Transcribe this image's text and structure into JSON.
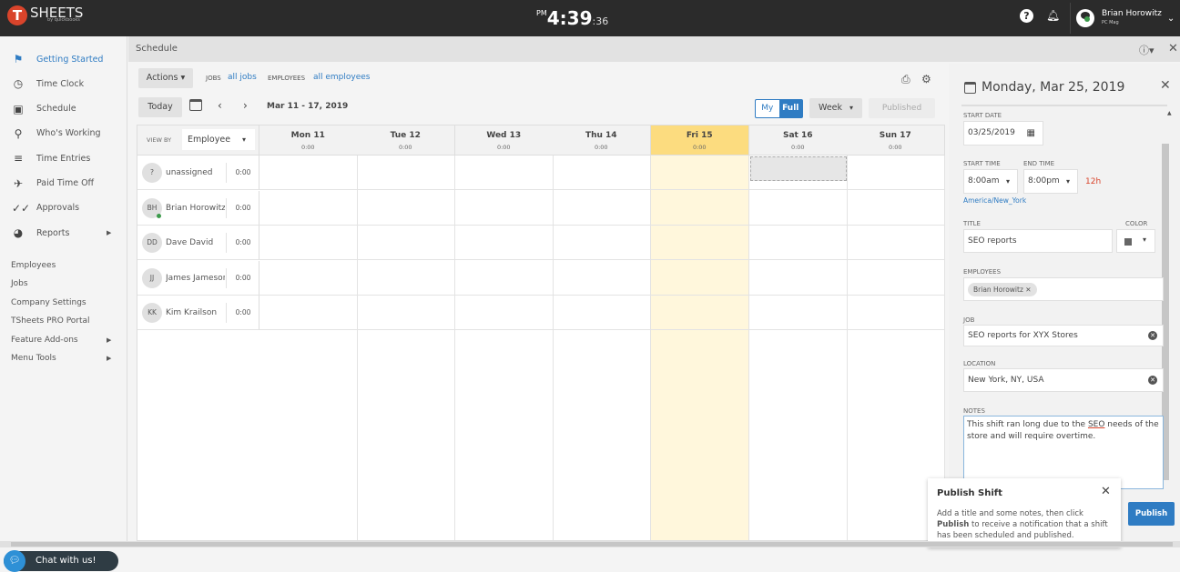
{
  "topbar": {
    "logo_letter": "T",
    "logo_text": "SHEETS",
    "logo_sub": "by quickbooks",
    "clock_ampm": "PM",
    "clock_hm": "4:39",
    "clock_sec": ":36",
    "help_icon": "?",
    "user_name": "Brian Horowitz",
    "user_org": "PC Mag"
  },
  "sidebar": {
    "items": [
      {
        "label": "Getting Started",
        "icon": "flag-icon",
        "glyph": "⚑",
        "active": true
      },
      {
        "label": "Time Clock",
        "icon": "clock-icon",
        "glyph": "◷"
      },
      {
        "label": "Schedule",
        "icon": "calendar-icon",
        "glyph": "▣"
      },
      {
        "label": "Who's Working",
        "icon": "location-pin-icon",
        "glyph": "⚲"
      },
      {
        "label": "Time Entries",
        "icon": "time-entries-icon",
        "glyph": "≡"
      },
      {
        "label": "Paid Time Off",
        "icon": "airplane-icon",
        "glyph": "✈"
      },
      {
        "label": "Approvals",
        "icon": "double-check-icon",
        "glyph": "✓✓"
      },
      {
        "label": "Reports",
        "icon": "pie-chart-icon",
        "glyph": "◕",
        "has_submenu": true
      }
    ],
    "sub_items": [
      {
        "label": "Employees"
      },
      {
        "label": "Jobs"
      },
      {
        "label": "Company Settings"
      },
      {
        "label": "TSheets PRO Portal"
      },
      {
        "label": "Feature Add-ons",
        "has_submenu": true
      },
      {
        "label": "Menu Tools",
        "has_submenu": true
      }
    ],
    "chat_label": "Chat with us!"
  },
  "schedule": {
    "title": "Schedule",
    "actions_label": "Actions",
    "jobs_label": "JOBS",
    "jobs_value": "all jobs",
    "employees_label": "EMPLOYEES",
    "employees_value": "all employees",
    "today_label": "Today",
    "date_range": "Mar 11 - 17, 2019",
    "toggle_my": "My",
    "toggle_full": "Full",
    "period": "Week",
    "published_label": "Published",
    "view_by_label": "VIEW BY",
    "view_by_value": "Employee",
    "days": [
      {
        "name": "Mon 11",
        "hours": "0:00"
      },
      {
        "name": "Tue 12",
        "hours": "0:00"
      },
      {
        "name": "Wed 13",
        "hours": "0:00"
      },
      {
        "name": "Thu 14",
        "hours": "0:00"
      },
      {
        "name": "Fri 15",
        "hours": "0:00",
        "today": true
      },
      {
        "name": "Sat 16",
        "hours": "0:00"
      },
      {
        "name": "Sun 17",
        "hours": "0:00"
      }
    ],
    "employees": [
      {
        "initials": "?",
        "name": "unassigned",
        "hours": "0:00"
      },
      {
        "initials": "BH",
        "name": "Brian Horowitz",
        "hours": "0:00",
        "online": true
      },
      {
        "initials": "DD",
        "name": "Dave David",
        "hours": "0:00"
      },
      {
        "initials": "JJ",
        "name": "James Jameson",
        "hours": "0:00"
      },
      {
        "initials": "KK",
        "name": "Kim Krailson",
        "hours": "0:00"
      }
    ]
  },
  "shift_panel": {
    "date_title": "Monday, Mar 25, 2019",
    "start_date_label": "START DATE",
    "start_date": "03/25/2019",
    "start_time_label": "START TIME",
    "start_time": "8:00am",
    "end_time_label": "END TIME",
    "end_time": "8:00pm",
    "duration": "12h",
    "timezone": "America/New_York",
    "title_label": "TITLE",
    "title_value": "SEO reports",
    "color_label": "COLOR",
    "color_value": "#666666",
    "employees_label": "EMPLOYEES",
    "employee_chip": "Brian Horowitz",
    "job_label": "JOB",
    "job_value": "SEO reports for XYX Stores",
    "location_label": "LOCATION",
    "location_value": "New York, NY, USA",
    "notes_label": "NOTES",
    "notes_before": "This shift ran long due to the ",
    "notes_underlined": "SEO",
    "notes_after": " needs of the store and will require overtime.",
    "publish_label": "Publish"
  },
  "popover": {
    "title": "Publish Shift",
    "body_1": "Add a title and some notes, then click ",
    "body_bold": "Publish",
    "body_2": " to receive a notification that a shift has been scheduled and published."
  },
  "colors": {
    "accent": "#2f7cc3",
    "today_header": "#fcdc7f",
    "today_column": "#fff7dc",
    "topbar": "#2b2b2b",
    "brand": "#d9442b"
  }
}
